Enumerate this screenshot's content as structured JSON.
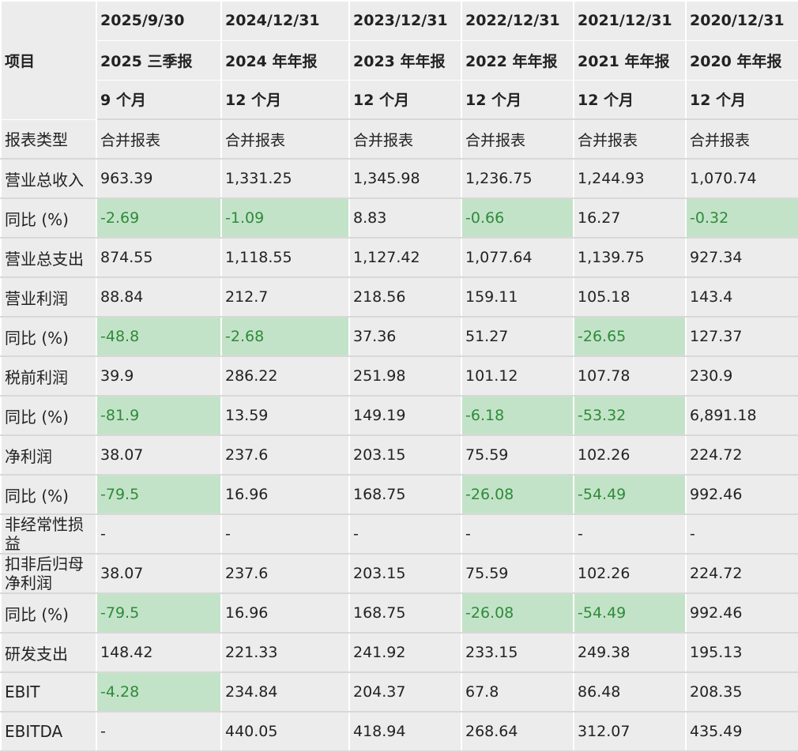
{
  "table": {
    "item_label": "项目",
    "columns": [
      {
        "date": "2025/9/30",
        "report": "2025 三季报",
        "period": "9 个月"
      },
      {
        "date": "2024/12/31",
        "report": "2024 年年报",
        "period": "12 个月"
      },
      {
        "date": "2023/12/31",
        "report": "2023 年年报",
        "period": "12 个月"
      },
      {
        "date": "2022/12/31",
        "report": "2022 年年报",
        "period": "12 个月"
      },
      {
        "date": "2021/12/31",
        "report": "2021 年年报",
        "period": "12 个月"
      },
      {
        "date": "2020/12/31",
        "report": "2020 年年报",
        "period": "12 个月"
      }
    ],
    "rows": [
      {
        "label": "报表类型",
        "values": [
          "合并报表",
          "合并报表",
          "合并报表",
          "合并报表",
          "合并报表",
          "合并报表"
        ],
        "highlight": [
          false,
          false,
          false,
          false,
          false,
          false
        ]
      },
      {
        "label": "营业总收入",
        "values": [
          "963.39",
          "1,331.25",
          "1,345.98",
          "1,236.75",
          "1,244.93",
          "1,070.74"
        ],
        "highlight": [
          false,
          false,
          false,
          false,
          false,
          false
        ]
      },
      {
        "label": "同比 (%)",
        "values": [
          "-2.69",
          "-1.09",
          "8.83",
          "-0.66",
          "16.27",
          "-0.32"
        ],
        "highlight": [
          true,
          true,
          false,
          true,
          false,
          true
        ]
      },
      {
        "label": "营业总支出",
        "values": [
          "874.55",
          "1,118.55",
          "1,127.42",
          "1,077.64",
          "1,139.75",
          "927.34"
        ],
        "highlight": [
          false,
          false,
          false,
          false,
          false,
          false
        ]
      },
      {
        "label": "营业利润",
        "values": [
          "88.84",
          "212.7",
          "218.56",
          "159.11",
          "105.18",
          "143.4"
        ],
        "highlight": [
          false,
          false,
          false,
          false,
          false,
          false
        ]
      },
      {
        "label": "同比 (%)",
        "values": [
          "-48.8",
          "-2.68",
          "37.36",
          "51.27",
          "-26.65",
          "127.37"
        ],
        "highlight": [
          true,
          true,
          false,
          false,
          true,
          false
        ]
      },
      {
        "label": "税前利润",
        "values": [
          "39.9",
          "286.22",
          "251.98",
          "101.12",
          "107.78",
          "230.9"
        ],
        "highlight": [
          false,
          false,
          false,
          false,
          false,
          false
        ]
      },
      {
        "label": "同比 (%)",
        "values": [
          "-81.9",
          "13.59",
          "149.19",
          "-6.18",
          "-53.32",
          "6,891.18"
        ],
        "highlight": [
          true,
          false,
          false,
          true,
          true,
          false
        ]
      },
      {
        "label": "净利润",
        "values": [
          "38.07",
          "237.6",
          "203.15",
          "75.59",
          "102.26",
          "224.72"
        ],
        "highlight": [
          false,
          false,
          false,
          false,
          false,
          false
        ]
      },
      {
        "label": "同比 (%)",
        "values": [
          "-79.5",
          "16.96",
          "168.75",
          "-26.08",
          "-54.49",
          "992.46"
        ],
        "highlight": [
          true,
          false,
          false,
          true,
          true,
          false
        ]
      },
      {
        "label": "非经常性损益",
        "values": [
          "-",
          "-",
          "-",
          "-",
          "-",
          "-"
        ],
        "highlight": [
          false,
          false,
          false,
          false,
          false,
          false
        ],
        "wrap": true
      },
      {
        "label": "扣非后归母净利润",
        "values": [
          "38.07",
          "237.6",
          "203.15",
          "75.59",
          "102.26",
          "224.72"
        ],
        "highlight": [
          false,
          false,
          false,
          false,
          false,
          false
        ],
        "wrap": true
      },
      {
        "label": "同比 (%)",
        "values": [
          "-79.5",
          "16.96",
          "168.75",
          "-26.08",
          "-54.49",
          "992.46"
        ],
        "highlight": [
          true,
          false,
          false,
          true,
          true,
          false
        ]
      },
      {
        "label": "研发支出",
        "values": [
          "148.42",
          "221.33",
          "241.92",
          "233.15",
          "249.38",
          "195.13"
        ],
        "highlight": [
          false,
          false,
          false,
          false,
          false,
          false
        ]
      },
      {
        "label": "EBIT",
        "values": [
          "-4.28",
          "234.84",
          "204.37",
          "67.8",
          "86.48",
          "208.35"
        ],
        "highlight": [
          true,
          false,
          false,
          false,
          false,
          false
        ]
      },
      {
        "label": "EBITDA",
        "values": [
          "-",
          "440.05",
          "418.94",
          "268.64",
          "312.07",
          "435.49"
        ],
        "highlight": [
          false,
          false,
          false,
          false,
          false,
          false
        ]
      }
    ]
  },
  "colors": {
    "cell_bg": "#ececec",
    "highlight_bg": "#c3e3c8",
    "highlight_text": "#2e8b3a"
  }
}
